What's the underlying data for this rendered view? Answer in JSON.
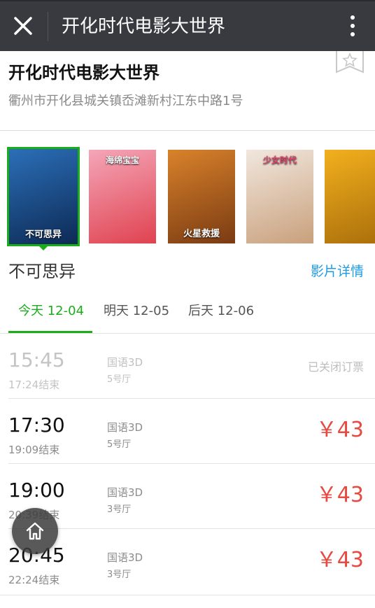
{
  "topbar": {
    "title": "开化时代电影大世界",
    "close_icon": "close-icon",
    "more_icon": "more-vertical-icon"
  },
  "cinema": {
    "name": "开化时代电影大世界",
    "address": "衢州市开化县城关镇岙滩新村江东中路1号",
    "bookmark_icon": "star-bookmark-icon"
  },
  "posters": [
    {
      "title": "不可思异",
      "selected": true,
      "colors": [
        "#2b6fb8",
        "#0d2a55"
      ]
    },
    {
      "title": "海绵宝宝",
      "selected": false,
      "colors": [
        "#f4a6b8",
        "#e0424f"
      ]
    },
    {
      "title": "火星救援",
      "selected": false,
      "colors": [
        "#d9822b",
        "#7a3b12"
      ]
    },
    {
      "title": "少女时代",
      "selected": false,
      "colors": [
        "#f1e7de",
        "#c9a07c"
      ]
    },
    {
      "title": "",
      "selected": false,
      "colors": [
        "#f2b01e",
        "#a86d0a"
      ]
    }
  ],
  "movie": {
    "title": "不可思异",
    "detail_link": "影片详情"
  },
  "tabs": [
    {
      "label": "今天 12-04",
      "active": true
    },
    {
      "label": "明天 12-05",
      "active": false
    },
    {
      "label": "后天 12-06",
      "active": false
    }
  ],
  "showtimes": [
    {
      "start": "15:45",
      "end": "17:24结束",
      "lang": "国语3D",
      "hall": "5号厅",
      "status": "已关闭订票",
      "price": ""
    },
    {
      "start": "17:30",
      "end": "19:09结束",
      "lang": "国语3D",
      "hall": "5号厅",
      "status": "",
      "price": "￥43"
    },
    {
      "start": "19:00",
      "end": "20:39结束",
      "lang": "国语3D",
      "hall": "3号厅",
      "status": "",
      "price": "￥43"
    },
    {
      "start": "20:45",
      "end": "22:24结束",
      "lang": "国语3D",
      "hall": "3号厅",
      "status": "",
      "price": "￥43"
    }
  ],
  "home_button": {
    "icon": "home-icon"
  },
  "colors": {
    "accent": "#1aad19",
    "price": "#e64a40",
    "link": "#1e9be6",
    "topbar": "#393a3f"
  }
}
